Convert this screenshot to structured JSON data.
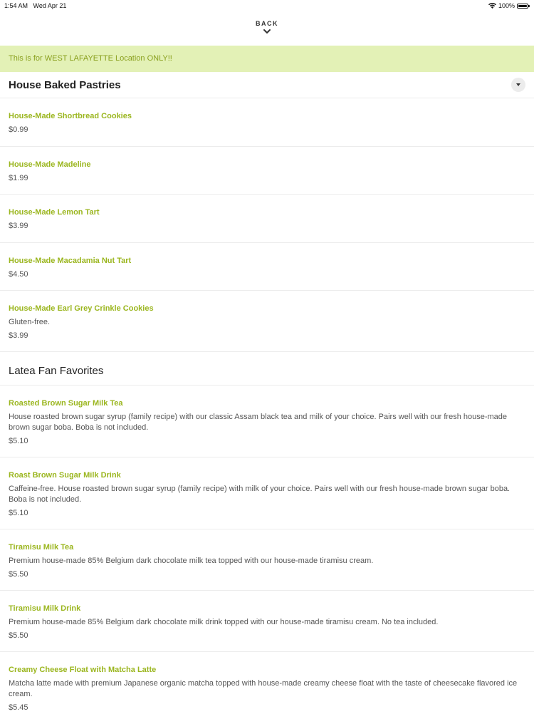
{
  "status_bar": {
    "time": "1:54 AM",
    "date": "Wed Apr 21",
    "battery": "100%",
    "battery_level": 1.0
  },
  "nav": {
    "back_label": "BACK",
    "back_icon": "chevron-down-icon"
  },
  "banner": {
    "text": "This is for WEST LAFAYETTE Location ONLY!!"
  },
  "colors": {
    "accent": "#9bb61f",
    "banner_bg": "#e3f1b6",
    "banner_text": "#8aa01e"
  },
  "sections": [
    {
      "title": "House Baked Pastries",
      "items": [
        {
          "name": "House-Made Shortbread Cookies",
          "desc": "",
          "price": "$0.99"
        },
        {
          "name": "House-Made Madeline",
          "desc": "",
          "price": "$1.99"
        },
        {
          "name": "House-Made Lemon Tart",
          "desc": "",
          "price": "$3.99"
        },
        {
          "name": "House-Made Macadamia Nut Tart",
          "desc": "",
          "price": "$4.50"
        },
        {
          "name": "House-Made Earl Grey Crinkle Cookies",
          "desc": "Gluten-free.",
          "price": "$3.99"
        }
      ]
    },
    {
      "title": "Latea Fan Favorites",
      "items": [
        {
          "name": "Roasted Brown Sugar Milk Tea",
          "desc": "House roasted brown sugar syrup (family recipe) with our classic Assam black tea and milk of your choice. Pairs well with our fresh house-made brown sugar boba. Boba is not included.",
          "price": "$5.10"
        },
        {
          "name": "Roast Brown Sugar Milk Drink",
          "desc": "Caffeine-free. House roasted brown sugar syrup (family recipe) with milk of your choice. Pairs well with our fresh house-made brown sugar boba. Boba is not included.",
          "price": "$5.10"
        },
        {
          "name": "Tiramisu Milk Tea",
          "desc": "Premium house-made 85% Belgium dark chocolate milk tea topped with our house-made tiramisu cream.",
          "price": "$5.50"
        },
        {
          "name": "Tiramisu Milk Drink",
          "desc": "Premium house-made 85% Belgium dark chocolate milk drink topped with our house-made tiramisu cream. No tea included.",
          "price": "$5.50"
        },
        {
          "name": "Creamy Cheese Float with Matcha Latte",
          "desc": "Matcha latte made with premium Japanese organic matcha topped with house-made creamy cheese float with the taste of cheesecake flavored ice cream.",
          "price": "$5.45"
        }
      ]
    }
  ]
}
